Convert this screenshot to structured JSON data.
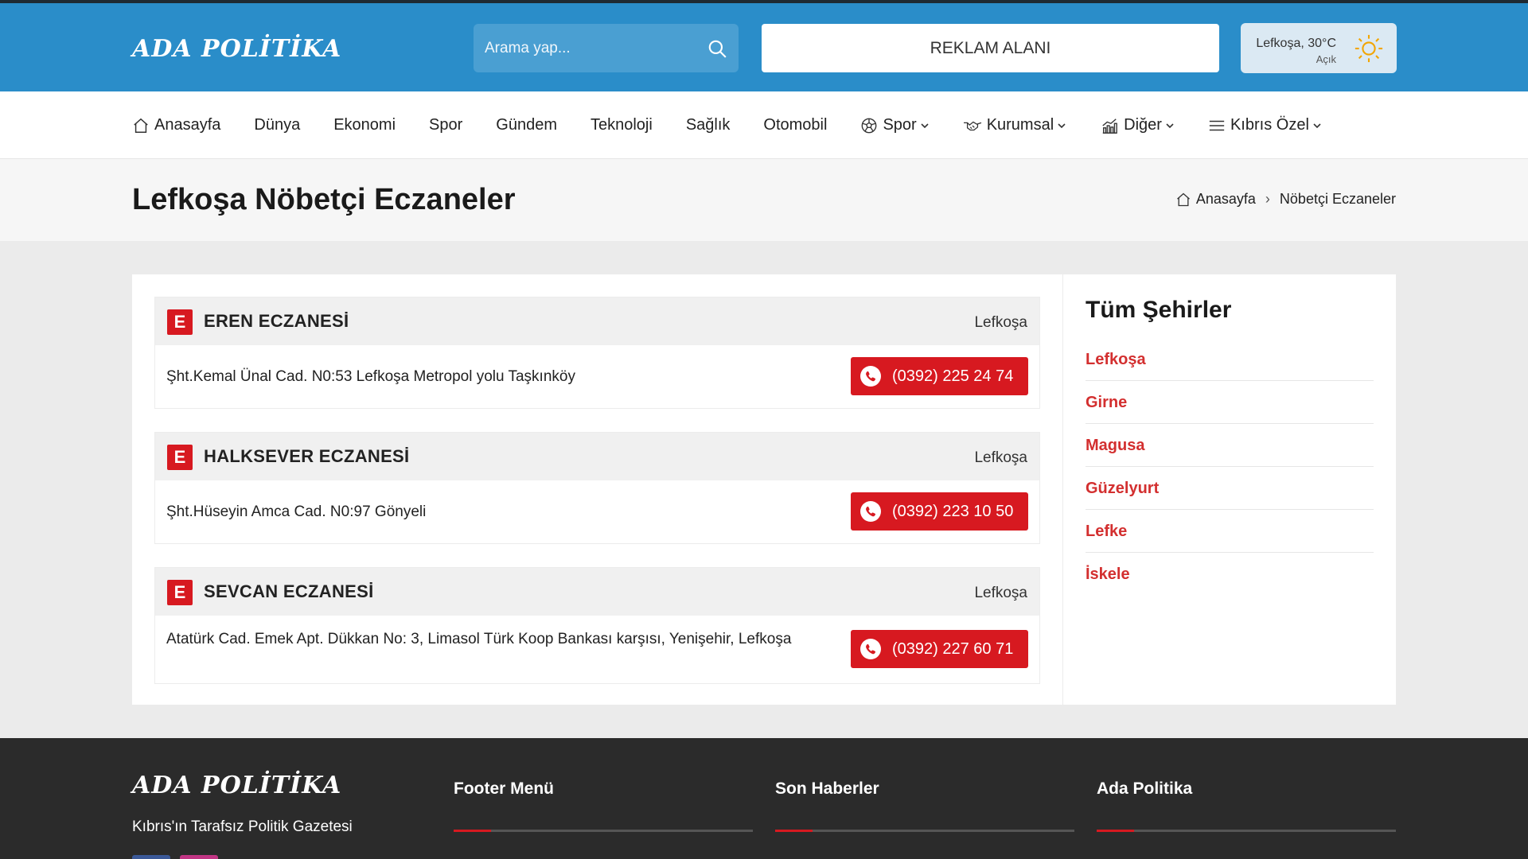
{
  "header": {
    "logo": "ADA POLİTİKA",
    "search_placeholder": "Arama yap...",
    "ad_label": "REKLAM ALANI",
    "weather": {
      "city_temp": "Lefkoşa, 30°C",
      "condition": "Açık"
    }
  },
  "nav": {
    "items": [
      {
        "label": "Anasayfa",
        "icon": "home-icon"
      },
      {
        "label": "Dünya"
      },
      {
        "label": "Ekonomi"
      },
      {
        "label": "Spor"
      },
      {
        "label": "Gündem"
      },
      {
        "label": "Teknoloji"
      },
      {
        "label": "Sağlık"
      },
      {
        "label": "Otomobil"
      },
      {
        "label": "Spor",
        "icon": "soccer-ball-icon",
        "dropdown": true
      },
      {
        "label": "Kurumsal",
        "icon": "handshake-icon",
        "dropdown": true
      },
      {
        "label": "Diğer",
        "icon": "chart-icon",
        "dropdown": true
      },
      {
        "label": "Kıbrıs Özel",
        "icon": "menu-icon",
        "dropdown": true
      }
    ]
  },
  "page": {
    "title": "Lefkoşa Nöbetçi Eczaneler",
    "breadcrumb": {
      "home": "Anasayfa",
      "current": "Nöbetçi Eczaneler"
    }
  },
  "pharmacies": [
    {
      "badge": "E",
      "name": "EREN ECZANESİ",
      "city": "Lefkoşa",
      "address": "Şht.Kemal Ünal Cad. N0:53 Lefkoşa Metropol yolu Taşkınköy",
      "phone": "(0392) 225 24 74"
    },
    {
      "badge": "E",
      "name": "HALKSEVER ECZANESİ",
      "city": "Lefkoşa",
      "address": "Şht.Hüseyin Amca Cad. N0:97 Gönyeli",
      "phone": "(0392) 223 10 50"
    },
    {
      "badge": "E",
      "name": "SEVCAN ECZANESİ",
      "city": "Lefkoşa",
      "address": "Atatürk Cad. Emek Apt. Dükkan No: 3, Limasol Türk Koop Bankası karşısı, Yenişehir, Lefkoşa",
      "phone": "(0392) 227 60 71"
    }
  ],
  "sidebar": {
    "title": "Tüm Şehirler",
    "cities": [
      "Lefkoşa",
      "Girne",
      "Magusa",
      "Güzelyurt",
      "Lefke",
      "İskele"
    ]
  },
  "footer": {
    "logo": "ADA POLİTİKA",
    "tagline": "Kıbrıs'ın Tarafsız Politik Gazetesi",
    "columns": [
      "Footer Menü",
      "Son Haberler",
      "Ada Politika"
    ]
  },
  "colors": {
    "header_bg": "#2a8dc9",
    "accent_red": "#d71920",
    "footer_bg": "#2b2b2b"
  }
}
